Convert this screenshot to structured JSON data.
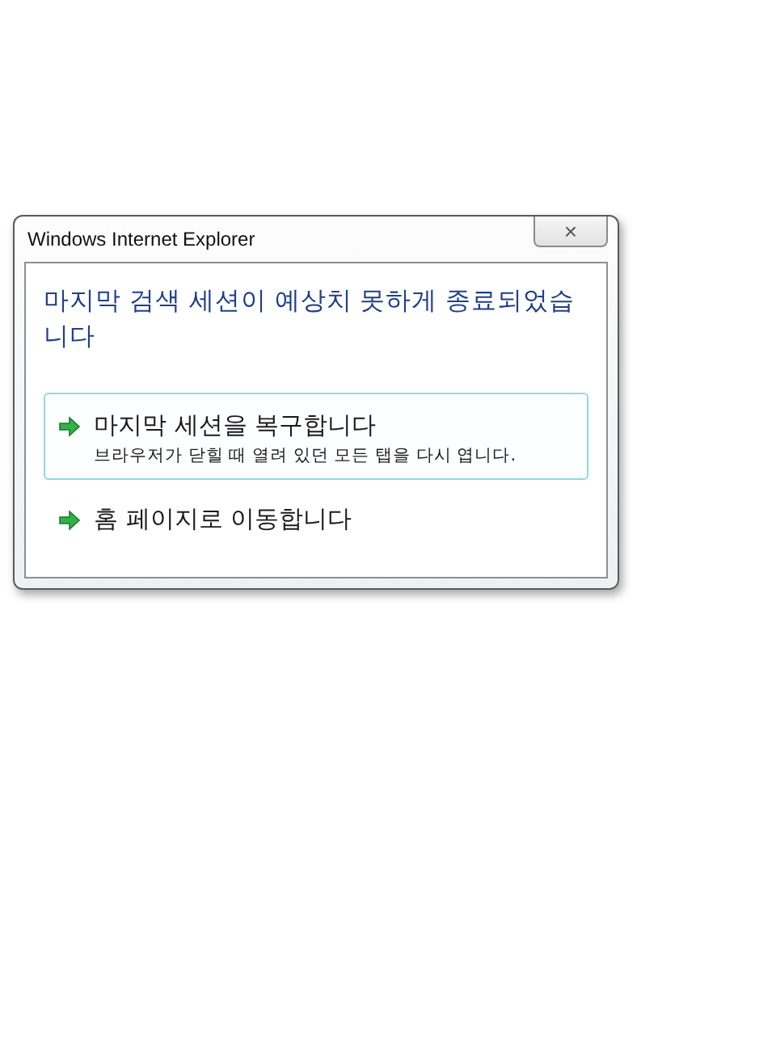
{
  "window": {
    "title": "Windows Internet Explorer",
    "close": "×"
  },
  "heading": "마지막 검색 세션이 예상치 못하게 종료되었습니다",
  "options": [
    {
      "label": "마지막 세션을 복구합니다",
      "description": "브라우저가 닫힐 때 열려 있던 모든 탭을 다시 엽니다.",
      "selected": true
    },
    {
      "label": "홈 페이지로 이동합니다",
      "selected": false
    }
  ]
}
